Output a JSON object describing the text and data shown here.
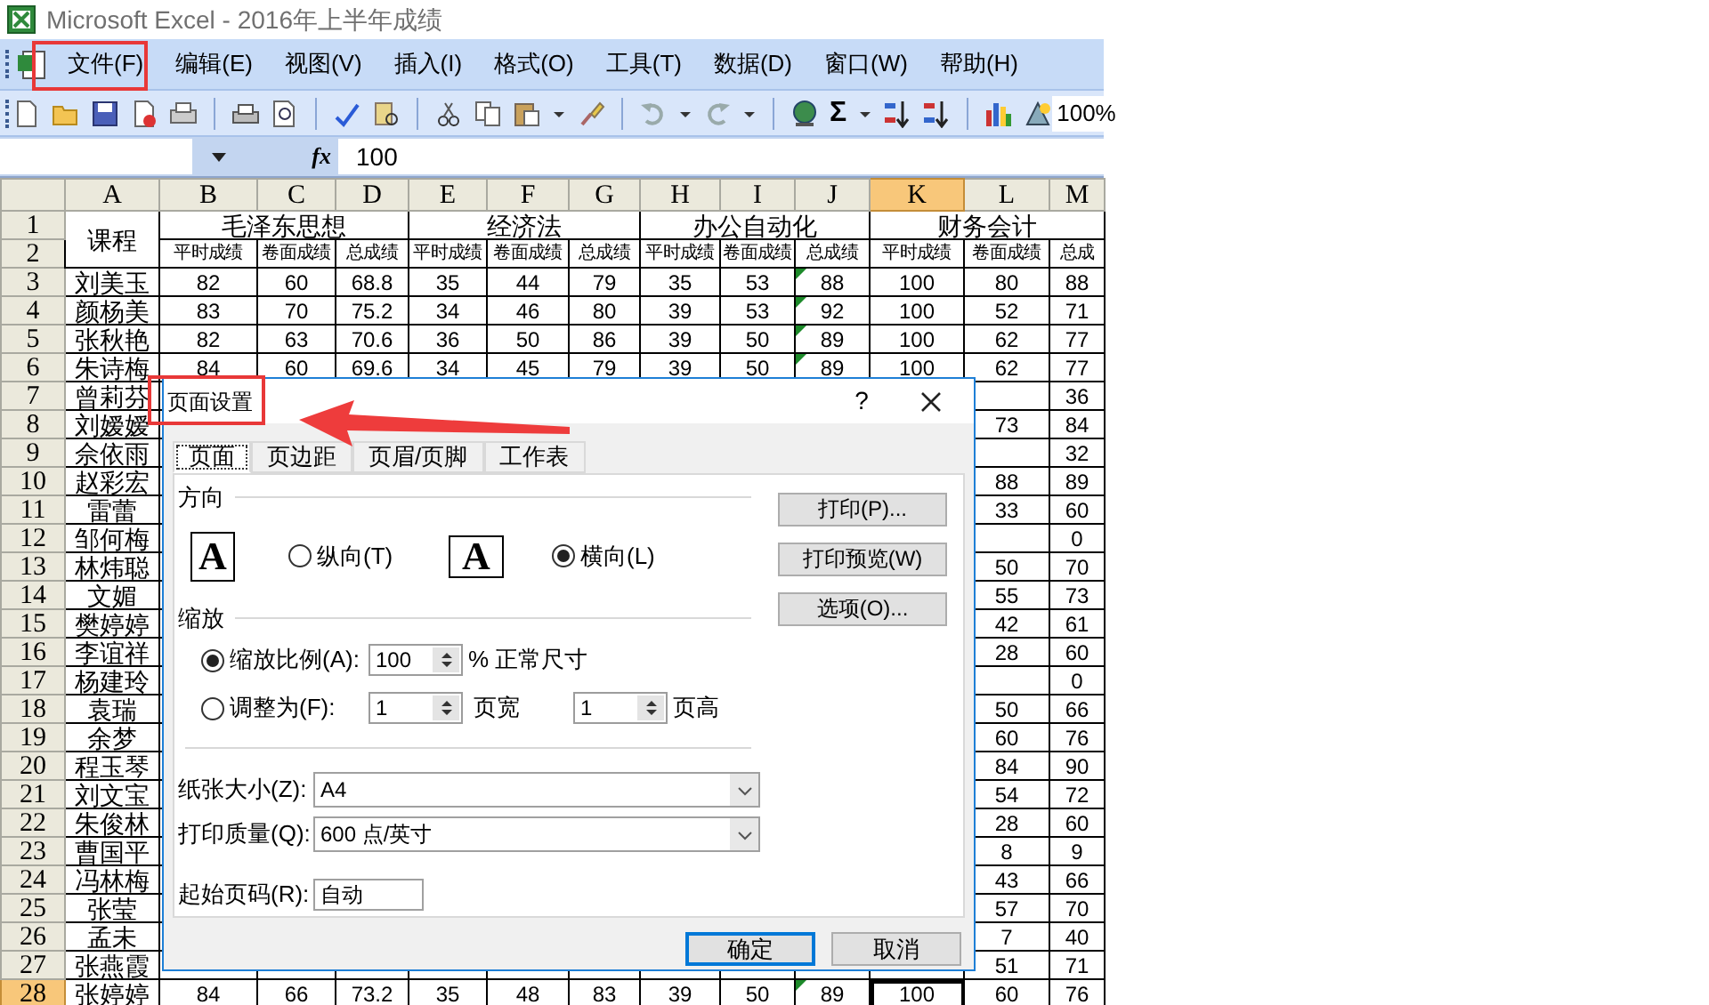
{
  "window": {
    "title": "Microsoft Excel - 2016年上半年成绩"
  },
  "menu": [
    "文件(F)",
    "编辑(E)",
    "视图(V)",
    "插入(I)",
    "格式(O)",
    "工具(T)",
    "数据(D)",
    "窗口(W)",
    "帮助(H)"
  ],
  "toolbar": {
    "sum": "Σ",
    "zoom": "100%"
  },
  "formula_bar": {
    "fx": "fx",
    "value": "100"
  },
  "columns": [
    {
      "label": "A",
      "selected": false
    },
    {
      "label": "B",
      "selected": false
    },
    {
      "label": "C",
      "selected": false
    },
    {
      "label": "D",
      "selected": false
    },
    {
      "label": "E",
      "selected": false
    },
    {
      "label": "F",
      "selected": false
    },
    {
      "label": "G",
      "selected": false
    },
    {
      "label": "H",
      "selected": false
    },
    {
      "label": "I",
      "selected": false
    },
    {
      "label": "J",
      "selected": false
    },
    {
      "label": "K",
      "selected": true
    },
    {
      "label": "L",
      "selected": false
    },
    {
      "label": "M",
      "selected": false
    }
  ],
  "header": {
    "row_1": "1",
    "row_2": "2",
    "first": "课程",
    "groups": [
      "毛泽东思想",
      "经济法",
      "办公自动化",
      "财务会计"
    ],
    "subheaders": [
      "平时成绩",
      "卷面成绩",
      "总成绩",
      "平时成绩",
      "卷面成绩",
      "总成绩",
      "平时成绩",
      "卷面成绩",
      "总成绩",
      "平时成绩",
      "卷面成绩",
      "总成"
    ]
  },
  "rows": [
    {
      "num": "3",
      "selected": false,
      "j_marker": true,
      "cells": [
        "刘美玉",
        "82",
        "60",
        "68.8",
        "35",
        "44",
        "79",
        "35",
        "53",
        "88",
        "100",
        "80",
        "88"
      ]
    },
    {
      "num": "4",
      "selected": false,
      "j_marker": true,
      "cells": [
        "颜杨美",
        "83",
        "70",
        "75.2",
        "34",
        "46",
        "80",
        "39",
        "53",
        "92",
        "100",
        "52",
        "71"
      ]
    },
    {
      "num": "5",
      "selected": false,
      "j_marker": true,
      "cells": [
        "张秋艳",
        "82",
        "63",
        "70.6",
        "36",
        "50",
        "86",
        "39",
        "50",
        "89",
        "100",
        "62",
        "77"
      ]
    },
    {
      "num": "6",
      "selected": false,
      "j_marker": true,
      "cells": [
        "朱诗梅",
        "84",
        "60",
        "69.6",
        "34",
        "45",
        "79",
        "39",
        "50",
        "89",
        "100",
        "62",
        "77"
      ]
    },
    {
      "num": "7",
      "selected": false,
      "j_marker": false,
      "cells": [
        "曾莉芬",
        null,
        null,
        null,
        null,
        null,
        null,
        null,
        null,
        null,
        null,
        null,
        "36"
      ]
    },
    {
      "num": "8",
      "selected": false,
      "j_marker": false,
      "cells": [
        "刘嫒嫒",
        null,
        null,
        null,
        null,
        null,
        null,
        null,
        null,
        null,
        null,
        "73",
        "84"
      ]
    },
    {
      "num": "9",
      "selected": false,
      "j_marker": false,
      "cells": [
        "佘依雨",
        null,
        null,
        null,
        null,
        null,
        null,
        null,
        null,
        null,
        null,
        null,
        "32"
      ]
    },
    {
      "num": "10",
      "selected": false,
      "j_marker": false,
      "cells": [
        "赵彩宏",
        null,
        null,
        null,
        null,
        null,
        null,
        null,
        null,
        null,
        null,
        "88",
        "89"
      ]
    },
    {
      "num": "11",
      "selected": false,
      "j_marker": false,
      "cells": [
        "雷蕾",
        null,
        null,
        null,
        null,
        null,
        null,
        null,
        null,
        null,
        null,
        "33",
        "60"
      ]
    },
    {
      "num": "12",
      "selected": false,
      "j_marker": false,
      "cells": [
        "邹何梅",
        null,
        null,
        null,
        null,
        null,
        null,
        null,
        null,
        null,
        null,
        null,
        "0"
      ]
    },
    {
      "num": "13",
      "selected": false,
      "j_marker": false,
      "cells": [
        "林炜聪",
        null,
        null,
        null,
        null,
        null,
        null,
        null,
        null,
        null,
        null,
        "50",
        "70"
      ]
    },
    {
      "num": "14",
      "selected": false,
      "j_marker": false,
      "cells": [
        "文媚",
        null,
        null,
        null,
        null,
        null,
        null,
        null,
        null,
        null,
        null,
        "55",
        "73"
      ]
    },
    {
      "num": "15",
      "selected": false,
      "j_marker": false,
      "cells": [
        "樊婷婷",
        null,
        null,
        null,
        null,
        null,
        null,
        null,
        null,
        null,
        null,
        "42",
        "61"
      ]
    },
    {
      "num": "16",
      "selected": false,
      "j_marker": false,
      "cells": [
        "李谊祥",
        null,
        null,
        null,
        null,
        null,
        null,
        null,
        null,
        null,
        null,
        "28",
        "60"
      ]
    },
    {
      "num": "17",
      "selected": false,
      "j_marker": false,
      "cells": [
        "杨建玲",
        null,
        null,
        null,
        null,
        null,
        null,
        null,
        null,
        null,
        null,
        null,
        "0"
      ]
    },
    {
      "num": "18",
      "selected": false,
      "j_marker": false,
      "cells": [
        "袁瑞",
        null,
        null,
        null,
        null,
        null,
        null,
        null,
        null,
        null,
        null,
        "50",
        "66"
      ]
    },
    {
      "num": "19",
      "selected": false,
      "j_marker": false,
      "cells": [
        "余梦",
        null,
        null,
        null,
        null,
        null,
        null,
        null,
        null,
        null,
        null,
        "60",
        "76"
      ]
    },
    {
      "num": "20",
      "selected": false,
      "j_marker": false,
      "cells": [
        "程玉琴",
        null,
        null,
        null,
        null,
        null,
        null,
        null,
        null,
        null,
        null,
        "84",
        "90"
      ]
    },
    {
      "num": "21",
      "selected": false,
      "j_marker": false,
      "cells": [
        "刘文宝",
        null,
        null,
        null,
        null,
        null,
        null,
        null,
        null,
        null,
        null,
        "54",
        "72"
      ]
    },
    {
      "num": "22",
      "selected": false,
      "j_marker": false,
      "cells": [
        "朱俊林",
        null,
        null,
        null,
        null,
        null,
        null,
        null,
        null,
        null,
        null,
        "28",
        "60"
      ]
    },
    {
      "num": "23",
      "selected": false,
      "j_marker": false,
      "cells": [
        "曹国平",
        null,
        null,
        null,
        null,
        null,
        null,
        null,
        null,
        null,
        null,
        "8",
        "9"
      ]
    },
    {
      "num": "24",
      "selected": false,
      "j_marker": false,
      "cells": [
        "冯林梅",
        null,
        null,
        null,
        null,
        null,
        null,
        null,
        null,
        null,
        null,
        "43",
        "66"
      ]
    },
    {
      "num": "25",
      "selected": false,
      "j_marker": false,
      "cells": [
        "张莹",
        null,
        null,
        null,
        null,
        null,
        null,
        null,
        null,
        null,
        null,
        "57",
        "70"
      ]
    },
    {
      "num": "26",
      "selected": false,
      "j_marker": false,
      "cells": [
        "孟未",
        null,
        null,
        null,
        null,
        null,
        null,
        null,
        null,
        null,
        null,
        "7",
        "40"
      ]
    },
    {
      "num": "27",
      "selected": false,
      "j_marker": false,
      "cells": [
        "张燕霞",
        null,
        null,
        null,
        null,
        null,
        null,
        null,
        null,
        null,
        null,
        "51",
        "71"
      ]
    },
    {
      "num": "28",
      "selected": true,
      "j_marker": true,
      "cells": [
        "张婷婷",
        "84",
        "66",
        "73.2",
        "35",
        "48",
        "83",
        "39",
        "50",
        "89",
        "100",
        "60",
        "76"
      ]
    }
  ],
  "dialog": {
    "title": "页面设置",
    "help": "?",
    "tabs": [
      {
        "label": "页面",
        "selected": true
      },
      {
        "label": "页边距",
        "selected": false
      },
      {
        "label": "页眉/页脚",
        "selected": false
      },
      {
        "label": "工作表",
        "selected": false
      }
    ],
    "orientation": {
      "label": "方向",
      "options": [
        {
          "kind": "portrait",
          "glyph": "A",
          "label": "纵向(T)",
          "selected": false
        },
        {
          "kind": "landscape",
          "glyph": "A",
          "label": "横向(L)",
          "selected": true
        }
      ]
    },
    "scaling": {
      "label": "缩放",
      "adjust": {
        "label": "缩放比例(A):",
        "selected": true,
        "value": "100",
        "suffix": "% 正常尺寸"
      },
      "fit": {
        "label": "调整为(F):",
        "selected": false,
        "wide_value": "1",
        "wide_unit": "页宽",
        "tall_value": "1",
        "tall_unit": "页高"
      }
    },
    "paper_size": {
      "label": "纸张大小(Z):",
      "value": "A4"
    },
    "print_quality": {
      "label": "打印质量(Q):",
      "value": "600 点/英寸"
    },
    "first_page": {
      "label": "起始页码(R):",
      "value": "自动"
    },
    "side_buttons": [
      "打印(P)...",
      "打印预览(W)",
      "选项(O)..."
    ],
    "footer_buttons": [
      {
        "label": "确定",
        "default": true
      },
      {
        "label": "取消",
        "default": false
      }
    ]
  }
}
